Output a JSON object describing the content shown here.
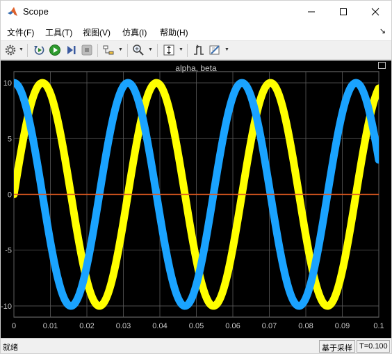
{
  "window": {
    "title": "Scope"
  },
  "menu": {
    "items": [
      "文件(F)",
      "工具(T)",
      "视图(V)",
      "仿真(I)",
      "帮助(H)"
    ]
  },
  "toolbar": {
    "icons": [
      "settings-icon",
      "restart-icon",
      "run-icon",
      "step-forward-icon",
      "stop-icon",
      "highlight-block-icon",
      "zoom-icon",
      "autoscale-icon",
      "trigger-icon",
      "measure-icon"
    ]
  },
  "status": {
    "state": "就绪",
    "sample_mode": "基于采样",
    "time": "T=0.100"
  },
  "colors": {
    "alpha": "#ffff00",
    "beta": "#1aa3ff",
    "zero": "#e05a20",
    "background": "#000000",
    "grid": "#5a5a5a",
    "axis_text": "#c8c8c8"
  },
  "chart_data": {
    "type": "line",
    "title": "alpha, beta",
    "xlabel": "",
    "ylabel": "",
    "xlim": [
      0,
      0.1
    ],
    "ylim": [
      -11,
      11
    ],
    "x_ticks": [
      "0",
      "0.01",
      "0.02",
      "0.03",
      "0.04",
      "0.05",
      "0.06",
      "0.07",
      "0.08",
      "0.09",
      "0.1"
    ],
    "y_ticks": [
      "10",
      "5",
      "0",
      "-5",
      "-10"
    ],
    "grid": true,
    "series": [
      {
        "key": "alpha",
        "function": "sin",
        "amplitude": 10,
        "frequency_hz": 32,
        "x_start": 0,
        "x_end": 0.1
      },
      {
        "key": "beta",
        "function": "cos",
        "amplitude": 10,
        "frequency_hz": 32,
        "x_start": 0,
        "x_end": 0.1
      },
      {
        "key": "zero",
        "function": "const",
        "value": 0,
        "x_start": 0,
        "x_end": 0.1
      }
    ]
  }
}
